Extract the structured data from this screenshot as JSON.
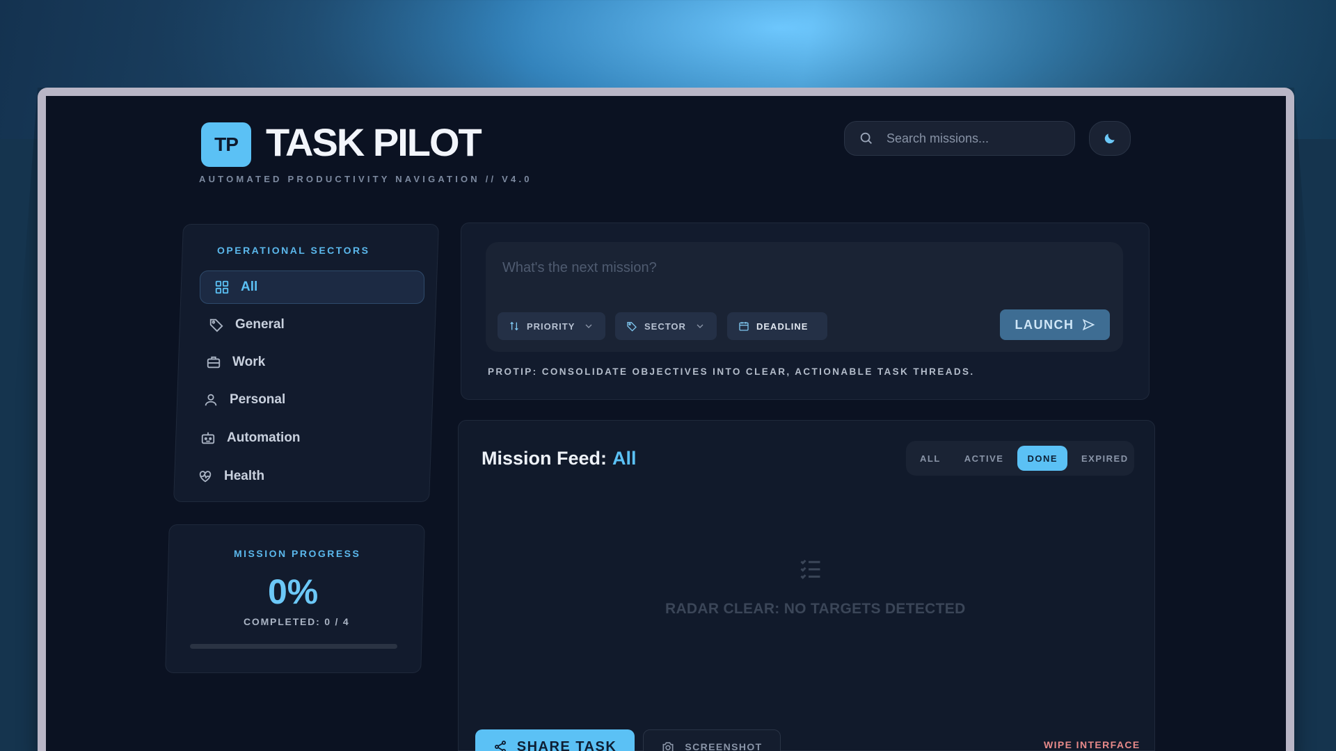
{
  "app": {
    "logo_text": "TP",
    "title": "TASK PILOT",
    "subtitle": "AUTOMATED PRODUCTIVITY NAVIGATION // V4.0"
  },
  "search": {
    "placeholder": "Search missions..."
  },
  "sidebar": {
    "heading": "OPERATIONAL SECTORS",
    "items": [
      {
        "label": "All",
        "icon": "grid-icon",
        "active": true
      },
      {
        "label": "General",
        "icon": "tag-icon"
      },
      {
        "label": "Work",
        "icon": "briefcase-icon"
      },
      {
        "label": "Personal",
        "icon": "user-icon"
      },
      {
        "label": "Automation",
        "icon": "robot-icon"
      },
      {
        "label": "Health",
        "icon": "heart-pulse-icon"
      }
    ]
  },
  "progress": {
    "heading": "MISSION PROGRESS",
    "percent": "0%",
    "completed": "COMPLETED: 0 / 4",
    "fraction": 0
  },
  "composer": {
    "placeholder": "What's the next mission?",
    "priority_label": "PRIORITY",
    "sector_label": "SECTOR",
    "deadline_label": "DEADLINE",
    "launch_label": "LAUNCH",
    "protip": "PROTIP: CONSOLIDATE OBJECTIVES INTO CLEAR, ACTIONABLE TASK THREADS."
  },
  "feed": {
    "title": "Mission Feed:",
    "sector": "All",
    "filters": [
      "ALL",
      "ACTIVE",
      "DONE",
      "EXPIRED"
    ],
    "active_filter": "DONE",
    "empty_text": "RADAR CLEAR: NO TARGETS DETECTED"
  },
  "footer": {
    "share_label": "SHARE TASK",
    "screenshot_label": "SCREENSHOT",
    "wipe_label": "WIPE INTERFACE"
  },
  "colors": {
    "accent": "#5bc1f5",
    "background": "#0b1222",
    "panel": "#121b2d",
    "danger": "#e88a8a"
  }
}
